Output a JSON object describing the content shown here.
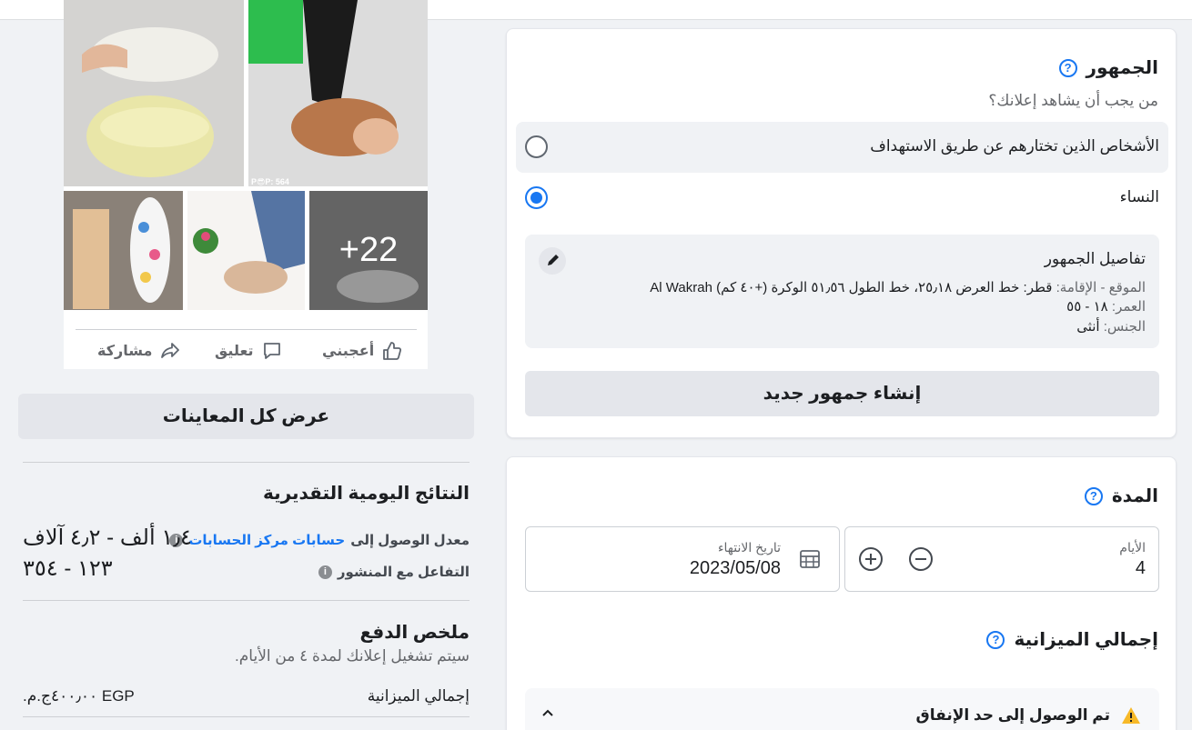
{
  "audience": {
    "title": "الجمهور",
    "question": "من يجب أن يشاهد إعلانك؟",
    "options": [
      {
        "label": "الأشخاص الذين تختارهم عن طريق الاستهداف",
        "selected": false
      },
      {
        "label": "النساء",
        "selected": true
      }
    ],
    "details": {
      "title": "تفاصيل الجمهور",
      "location_key": "الموقع - الإقامة:",
      "location_val": "قطر: خط العرض ٢٥٫١٨، خط الطول ٥١٫٥٦ الوكرة (+٤٠ كم) Al Wakrah",
      "age_key": "العمر:",
      "age_val": "١٨ - ٥٥",
      "gender_key": "الجنس:",
      "gender_val": "أنثى"
    },
    "create_button": "إنشاء جمهور جديد"
  },
  "duration": {
    "title": "المدة",
    "days_label": "الأيام",
    "days_value": "4",
    "end_label": "تاريخ الانتهاء",
    "end_value": "2023/05/08"
  },
  "budget": {
    "title": "إجمالي الميزانية",
    "warning": "تم الوصول إلى حد الإنفاق"
  },
  "post": {
    "overlay_text": "P😎P: 564",
    "more_count": "+22",
    "actions": {
      "like": "أعجبني",
      "comment": "تعليق",
      "share": "مشاركة"
    }
  },
  "left": {
    "view_all_button": "عرض كل المعاينات",
    "results_title": "النتائج اليومية التقديرية",
    "reach_label_prefix": "معدل الوصول إلى",
    "reach_link": "حسابات مركز الحسابات",
    "reach_value": "١٫٤ ألف - ٤٫٢ آلاف",
    "engagement_label": "التفاعل مع المنشور",
    "engagement_value": "١٢٣ - ٣٥٤",
    "payment_title": "ملخص الدفع",
    "payment_note": "سيتم تشغيل إعلانك لمدة ٤ من الأيام.",
    "total_label": "إجمالي الميزانية",
    "total_value": "٤٠٠٫٠٠ج.م.‏ EGP"
  },
  "colors": {
    "accent": "#1877f2",
    "background": "#f0f2f5",
    "warning": "#f7b928"
  }
}
